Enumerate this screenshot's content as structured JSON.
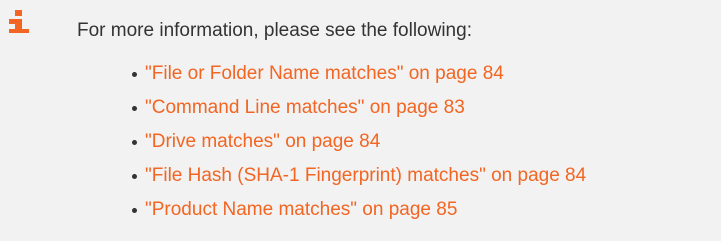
{
  "note": {
    "icon": "info-icon",
    "icon_color": "#f26522",
    "intro_text": "For more information, please see the following:",
    "link_color": "#f26522",
    "links": [
      {
        "text": "\"File or Folder Name matches\" on page 84"
      },
      {
        "text": "\"Command Line matches\" on page 83"
      },
      {
        "text": "\"Drive matches\" on page 84"
      },
      {
        "text": "\"File Hash (SHA-1 Fingerprint) matches\" on page 84"
      },
      {
        "text": "\"Product Name matches\" on page 85"
      }
    ]
  }
}
